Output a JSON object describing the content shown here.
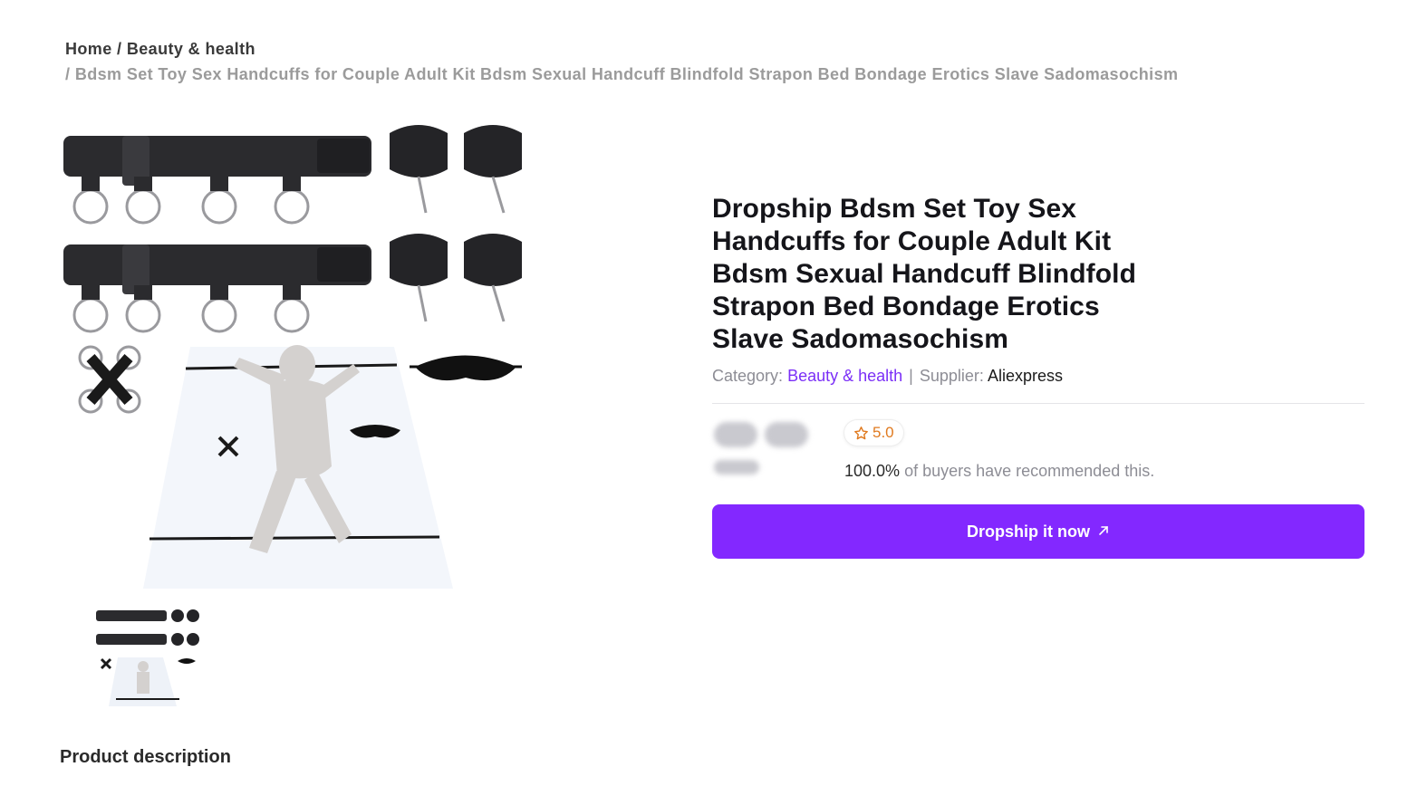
{
  "breadcrumb": {
    "home": "Home",
    "separator": "/",
    "category": "Beauty & health",
    "current": "Bdsm Set Toy Sex Handcuffs for Couple Adult Kit Bdsm Sexual Handcuff Blindfold Strapon Bed Bondage Erotics Slave Sadomasochism"
  },
  "product": {
    "title": "Dropship Bdsm Set Toy Sex Handcuffs for Couple Adult Kit Bdsm Sexual Handcuff Blindfold Strapon Bed Bondage Erotics Slave Sadomasochism",
    "category_label": "Category:",
    "category": "Beauty & health",
    "meta_divider": "|",
    "supplier_label": "Supplier:",
    "supplier": "Aliexpress",
    "rating": "5.0",
    "recommend_pct": "100.0%",
    "recommend_text": "of buyers have recommended this.",
    "cta_label": "Dropship it now"
  },
  "description": {
    "heading": "Product description"
  },
  "icons": {
    "rating": "star-outline-icon",
    "cta": "arrow-up-right-icon"
  },
  "colors": {
    "accent": "#8328ff",
    "link": "#7b2ff7",
    "rating": "#e07a1f"
  }
}
